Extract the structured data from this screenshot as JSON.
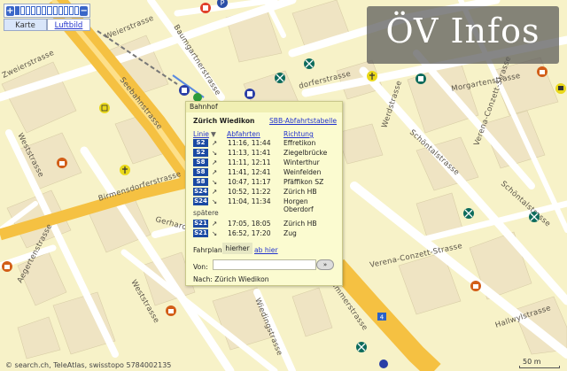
{
  "app": {
    "title": "ÖV Infos"
  },
  "zoom": {
    "plus_label": "+",
    "minus_label": "−",
    "steps": 12,
    "active_step": 0
  },
  "maptabs": {
    "karte": "Karte",
    "luftbild": "Luftbild"
  },
  "streets": {
    "weierstrasse": "Weierstrasse",
    "baumgartnerstrasse": "Baumgartnerstrasse",
    "zweierstrasse": "Zweierstrasse",
    "seebahnstrasse": "Seebahnstrasse",
    "birmensdorferstrasse": "Birmensdorferstrasse",
    "dorferstrasse": "dorferstrasse",
    "weststrasse_left": "Weststrasse",
    "aegertenstrasse": "Aegertenstrasse",
    "gerhardstrasse": "Gerhardstr.",
    "weststrasse_mid": "Weststrasse",
    "wiedingstrasse": "Wiedingstrasse",
    "morgartenstrasse": "Morgartenstrasse",
    "werdstrasse": "Werdstrasse",
    "schontalstrasse_a": "Schöntalstrasse",
    "schontalstrasse_b": "Schöntalstrasse",
    "verena_conzett": "Verena-Conzett-Strasse",
    "verena_conzett_b": "Verena-Conzett-Strasse",
    "hallwylstrasse": "Hallwylstrasse",
    "zimmerstrasse": "Zimmerstrasse"
  },
  "road_number": "4",
  "popup": {
    "type": "Bahnhof",
    "station": "Zürich Wiedikon",
    "sbb_link": "SBB-Abfahrtstabelle",
    "col_line": "Linie",
    "col_line_sort": "▼",
    "col_departures": "Abfahrten",
    "col_direction": "Richtung",
    "rows": [
      {
        "line": "S2",
        "arrow": "↗",
        "times": "11:16, 11:44",
        "dest": "Effretikon"
      },
      {
        "line": "S2",
        "arrow": "↘",
        "times": "11:13, 11:41",
        "dest": "Ziegelbrücke"
      },
      {
        "line": "S8",
        "arrow": "↗",
        "times": "11:11, 12:11",
        "dest": "Winterthur"
      },
      {
        "line": "S8",
        "arrow": "↗",
        "times": "11:41, 12:41",
        "dest": "Weinfelden"
      },
      {
        "line": "S8",
        "arrow": "↘",
        "times": "10:47, 11:17",
        "dest": "Pfäffikon SZ"
      },
      {
        "line": "S24",
        "arrow": "↗",
        "times": "10:52, 11:22",
        "dest": "Zürich HB"
      },
      {
        "line": "S24",
        "arrow": "↘",
        "times": "11:04, 11:34",
        "dest": "Horgen Oberdorf"
      }
    ],
    "later_label": "spätere",
    "later_rows": [
      {
        "line": "S21",
        "arrow": "↗",
        "times": "17:05, 18:05",
        "dest": "Zürich HB"
      },
      {
        "line": "S21",
        "arrow": "↘",
        "times": "16:52, 17:20",
        "dest": "Zug"
      }
    ],
    "fahrplan_label": "Fahrplan",
    "tab_hierher": "hierher",
    "tab_abhier": "ab hier",
    "von_label": "Von:",
    "von_value": "",
    "go_label": "»",
    "nach_label": "Nach: Zürich Wiedikon"
  },
  "copyright": "© search.ch, TeleAtlas, swisstopo 5784002135",
  "scale_label": "50 m",
  "colors": {
    "main_road": "#f7c64a",
    "road": "#ffffff",
    "building": "#efe6c7",
    "background": "#f7f2c8",
    "badge": "#1b4aa3"
  },
  "pois": [
    "tram-stop-icon",
    "bus-stop-icon",
    "parking-icon",
    "restaurant-icon",
    "church-icon",
    "school-icon",
    "shop-icon",
    "post-office-icon"
  ]
}
